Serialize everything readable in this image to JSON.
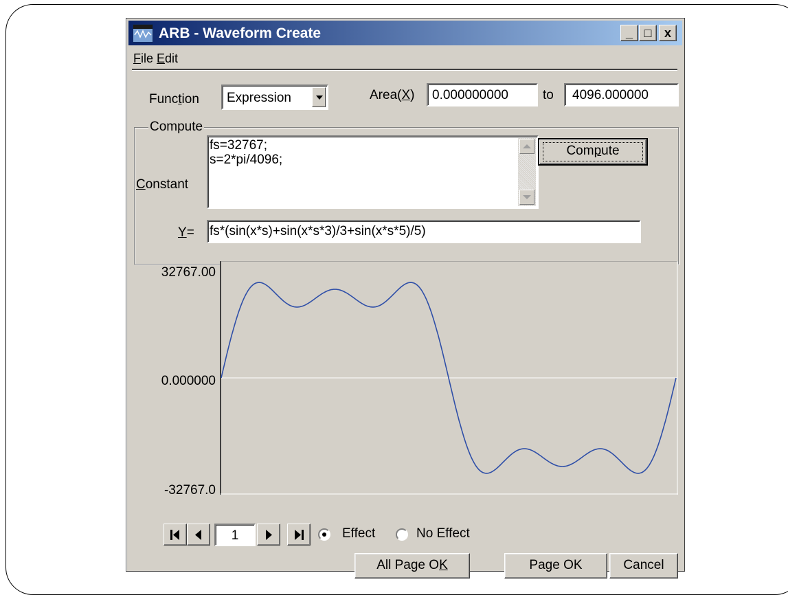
{
  "window": {
    "title": "ARB - Waveform Create",
    "controls": {
      "minimize": "_",
      "maximize": "□",
      "close": "x"
    }
  },
  "menu": {
    "items": [
      "File",
      "Edit"
    ]
  },
  "function": {
    "label_prefix": "Func",
    "label_mnemonic": "t",
    "label_suffix": "ion",
    "value": "Expression"
  },
  "area": {
    "label_prefix": "Area(",
    "label_mnemonic": "X",
    "label_suffix": ")",
    "from": "0.000000000",
    "to_label": "to",
    "to": "4096.000000"
  },
  "compute": {
    "group_title": "Compute",
    "constant_label_mnemonic": "C",
    "constant_label_rest": "onstant",
    "constants": [
      "fs=32767;",
      "s=2*pi/4096;"
    ],
    "button_prefix": "Com",
    "button_mnemonic": "p",
    "button_suffix": "ute",
    "y_label_mnemonic": "Y",
    "y_label_rest": "=",
    "y_expression": "fs*(sin(x*s)+sin(x*s*3)/3+sin(x*s*5)/5)"
  },
  "chart_data": {
    "type": "line",
    "y_tick_labels": [
      "32767.00",
      "0.000000",
      "-32767.0"
    ],
    "ylim": [
      -32767,
      32767
    ],
    "xlim": [
      0,
      4096
    ],
    "expression": "fs*(sin(x*s)+sin(x*s*3)/3+sin(x*s*5)/5)",
    "fs": 32767,
    "points": 4096,
    "line_color": "#2f4fa8",
    "zero_line_color": "#ffffff"
  },
  "pager": {
    "page": "1"
  },
  "mode": {
    "effect": "Effect",
    "no_effect": "No Effect",
    "selected": "Effect"
  },
  "buttons": {
    "all_page_ok_prefix": "All Page O",
    "all_page_ok_mnemonic": "K",
    "page_ok_prefix": "Pa",
    "page_ok_mnemonic": "g",
    "page_ok_suffix": "e OK",
    "cancel": "Cancel"
  }
}
